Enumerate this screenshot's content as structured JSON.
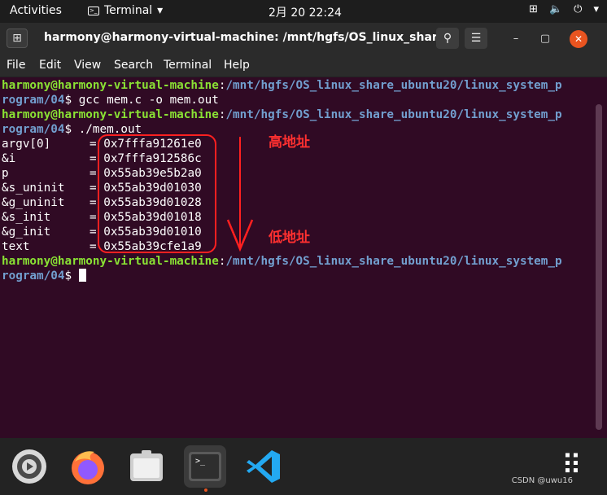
{
  "topbar": {
    "activities": "Activities",
    "app_name": "Terminal",
    "app_arrow": "▾",
    "clock": "2月 20  22:24",
    "tray": {
      "network": "⊞",
      "volume": "🔈",
      "power": "⏻",
      "arrow": "▾"
    }
  },
  "window": {
    "title": "harmony@harmony-virtual-machine: /mnt/hgfs/OS_linux_share...",
    "search_glyph": "⚲",
    "menu_glyph": "☰",
    "minimize": "–",
    "maximize": "▢",
    "close": "✕",
    "newtab": "⊞"
  },
  "menu": [
    "File",
    "Edit",
    "View",
    "Search",
    "Terminal",
    "Help"
  ],
  "console": {
    "user_host": "harmony@harmony-virtual-machine",
    "colon": ":",
    "path_part1": "/mnt/hgfs/OS_linux_share_ubuntu20/linux_system_p",
    "path_part2": "rogram/04",
    "prompt_end": "$ ",
    "cmd1": "gcc mem.c -o mem.out",
    "cmd2": "./mem.out",
    "output": [
      {
        "label": "argv[0]",
        "sep": "=",
        "value": "0x7fffa91261e0"
      },
      {
        "label": "&i",
        "sep": "=",
        "value": "0x7fffa912586c"
      },
      {
        "label": "p",
        "sep": "=",
        "value": "0x55ab39e5b2a0"
      },
      {
        "label": "&s_uninit",
        "sep": "=",
        "value": "0x55ab39d01030"
      },
      {
        "label": "&g_uninit",
        "sep": "=",
        "value": "0x55ab39d01028"
      },
      {
        "label": "&s_init",
        "sep": "=",
        "value": "0x55ab39d01018"
      },
      {
        "label": "&g_init",
        "sep": "=",
        "value": "0x55ab39d01010"
      },
      {
        "label": "text",
        "sep": "=",
        "value": "0x55ab39cfe1a9"
      }
    ]
  },
  "annotations": {
    "high": "高地址",
    "low": "低地址",
    "color": "#ff2020"
  },
  "dock": {
    "items": [
      {
        "name": "help-app"
      },
      {
        "name": "firefox"
      },
      {
        "name": "files"
      },
      {
        "name": "terminal",
        "glyph": ">_"
      },
      {
        "name": "vscode"
      }
    ],
    "apps_grid": "⠿"
  },
  "watermark": "CSDN @uwu16",
  "colors": {
    "terminal_bg": "#300a24",
    "prompt_user": "#8ae234",
    "prompt_path": "#729fcf",
    "accent": "#e95420"
  }
}
